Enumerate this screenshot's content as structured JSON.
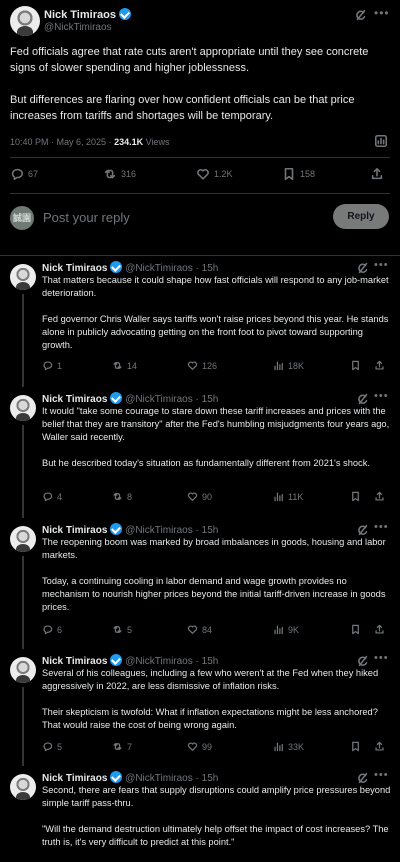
{
  "main_tweet": {
    "author": "Nick Timiraos",
    "handle": "@NickTimiraos",
    "text": "Fed officials agree that rate cuts aren't appropriate until they see concrete signs of slower spending and higher joblessness.\n\nBut differences are flaring over how confident officials can be that price increases from tariffs and shortages will be temporary.",
    "time": "10:40 PM · May 6, 2025 · ",
    "views_value": "234.1K",
    "views_label": " Views",
    "replies": "67",
    "reposts": "316",
    "likes": "1.2K",
    "bookmarks": "158"
  },
  "reply_box": {
    "avatar_text": "誠園",
    "placeholder": "Post your reply",
    "button": "Reply"
  },
  "replies": [
    {
      "author": "Nick Timiraos",
      "handle": "@NickTimiraos · 15h",
      "text": "That matters because it could shape how fast officials will respond to any job-market deterioration.\n\nFed governor Chris Waller says tariffs won't raise prices beyond this year. He stands alone in publicly advocating getting on the front foot to pivot toward supporting growth.",
      "replies": "1",
      "reposts": "14",
      "likes": "126",
      "views": "18K"
    },
    {
      "author": "Nick Timiraos",
      "handle": "@NickTimiraos · 15h",
      "text": "It would \"take some courage to stare down these tariff increases and prices with the belief that they are transitory\" after the Fed's humbling misjudgments four years ago, Waller said recently.\n\nBut he described today's situation as fundamentally different from 2021's shock.",
      "replies": "4",
      "reposts": "8",
      "likes": "90",
      "views": "11K"
    },
    {
      "author": "Nick Timiraos",
      "handle": "@NickTimiraos · 15h",
      "text": "The reopening boom was marked by broad imbalances in goods, housing and labor markets.\n\nToday, a continuing cooling in labor demand and wage growth provides no mechanism to nourish higher prices beyond the initial tariff-driven increase in goods prices.",
      "replies": "6",
      "reposts": "5",
      "likes": "84",
      "views": "9K"
    },
    {
      "author": "Nick Timiraos",
      "handle": "@NickTimiraos · 15h",
      "text": "Several of his colleagues, including a few who weren't at the Fed when they hiked aggressively in 2022, are less dismissive of inflation risks.\n\nTheir skepticism is twofold: What if inflation expectations might be less anchored? That would raise the cost of being wrong again.",
      "replies": "5",
      "reposts": "7",
      "likes": "99",
      "views": "33K"
    },
    {
      "author": "Nick Timiraos",
      "handle": "@NickTimiraos · 15h",
      "text": "Second, there are fears that supply disruptions could amplify price pressures beyond simple tariff pass-thru.\n\n\"Will the demand destruction ultimately help offset the impact of cost increases? The truth is, it's very difficult to predict at this point.\"",
      "replies": "",
      "reposts": "",
      "likes": "",
      "views": ""
    }
  ],
  "colors": {
    "background": "#000000",
    "text": "#e7e9ea",
    "muted": "#71767b",
    "verified": "#1d9bf0",
    "divider": "#2f3336"
  },
  "icons": [
    "verified-badge-icon",
    "grok-icon",
    "more-icon",
    "reply-icon",
    "repost-icon",
    "like-icon",
    "views-icon",
    "bookmark-icon",
    "share-icon",
    "post-analytics-icon"
  ]
}
